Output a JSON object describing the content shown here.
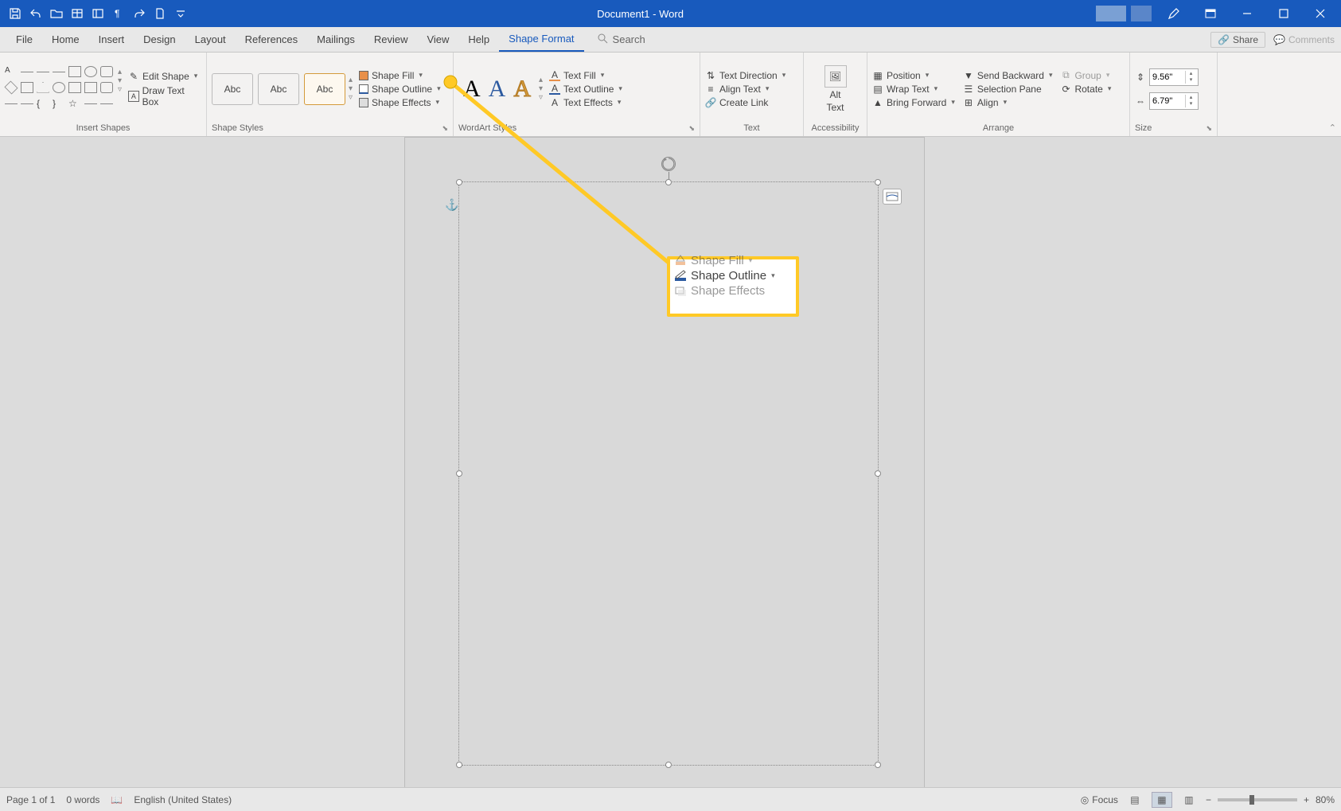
{
  "title": "Document1 - Word",
  "tabs": {
    "file": "File",
    "home": "Home",
    "insert": "Insert",
    "design": "Design",
    "layout": "Layout",
    "references": "References",
    "mailings": "Mailings",
    "review": "Review",
    "view": "View",
    "help": "Help",
    "shape_format": "Shape Format",
    "search": "Search"
  },
  "share": "Share",
  "comments": "Comments",
  "groups": {
    "insert_shapes": "Insert Shapes",
    "shape_styles": "Shape Styles",
    "wordart": "WordArt Styles",
    "text": "Text",
    "accessibility": "Accessibility",
    "arrange": "Arrange",
    "size": "Size"
  },
  "insert_shapes": {
    "edit_shape": "Edit Shape",
    "draw_text_box": "Draw Text Box"
  },
  "shape_styles": {
    "abc": "Abc",
    "fill": "Shape Fill",
    "outline": "Shape Outline",
    "effects": "Shape Effects"
  },
  "wordart_btns": {
    "text_fill": "Text Fill",
    "text_outline": "Text Outline",
    "text_effects": "Text Effects"
  },
  "text_group": {
    "direction": "Text Direction",
    "align": "Align Text",
    "link": "Create Link"
  },
  "alt_text_lines": {
    "l1": "Alt",
    "l2": "Text"
  },
  "arrange": {
    "position": "Position",
    "wrap": "Wrap Text",
    "forward": "Bring Forward",
    "backward": "Send Backward",
    "selpane": "Selection Pane",
    "align": "Align",
    "group": "Group",
    "rotate": "Rotate"
  },
  "size": {
    "height": "9.56\"",
    "width": "6.79\""
  },
  "callout": {
    "fill": "Shape Fill",
    "outline": "Shape Outline",
    "effects": "Shape Effects"
  },
  "status": {
    "page": "Page 1 of 1",
    "words": "0 words",
    "lang": "English (United States)",
    "focus": "Focus",
    "zoom": "80%"
  }
}
